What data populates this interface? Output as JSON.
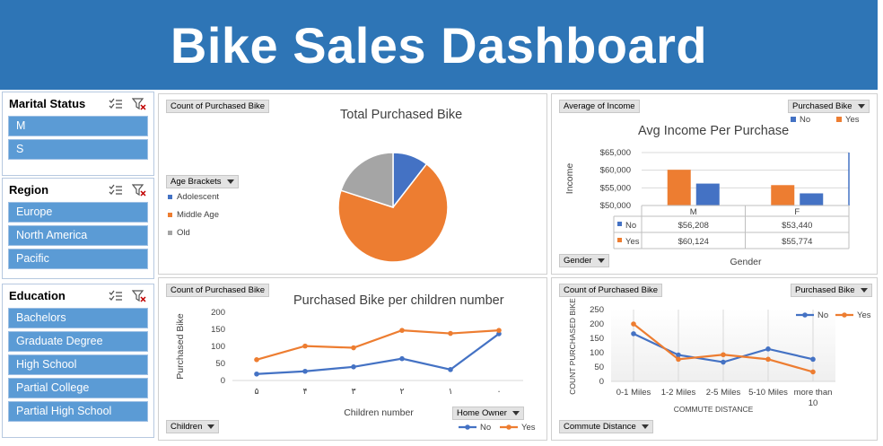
{
  "header": {
    "title": "Bike Sales Dashboard"
  },
  "slicers": {
    "marital": {
      "title": "Marital Status",
      "items": [
        "M",
        "S"
      ]
    },
    "region": {
      "title": "Region",
      "items": [
        "Europe",
        "North America",
        "Pacific"
      ]
    },
    "education": {
      "title": "Education",
      "items": [
        "Bachelors",
        "Graduate Degree",
        "High School",
        "Partial College",
        "Partial High School"
      ]
    }
  },
  "pie_panel": {
    "field_value": "Count of Purchased Bike",
    "legend_field": "Age Brackets",
    "legend_labels": [
      "Adolescent",
      "Middle Age",
      "Old"
    ]
  },
  "income_panel": {
    "field_value": "Average of Income",
    "field_series": "Purchased Bike",
    "field_axis": "Gender",
    "table": {
      "no_label": "No",
      "yes_label": "Yes",
      "no_values": [
        "$56,208",
        "$53,440"
      ],
      "yes_values": [
        "$60,124",
        "$55,774"
      ]
    }
  },
  "children_panel": {
    "field_value": "Count of Purchased Bike",
    "field_axis": "Children",
    "field_series": "Home Owner"
  },
  "commute_panel": {
    "field_value": "Count of Purchased Bike",
    "field_series": "Purchased Bike",
    "field_axis": "Commute Distance"
  },
  "colors": {
    "blue": "#4472c4",
    "orange": "#ed7d31",
    "gray": "#a5a5a5",
    "slicer": "#5b9bd5",
    "header": "#2e75b6"
  },
  "chart_data": [
    {
      "type": "pie",
      "title": "Total Purchased Bike",
      "categories": [
        "Adolescent",
        "Middle Age",
        "Old"
      ],
      "values": [
        10.5,
        69.5,
        20
      ],
      "colors": [
        "#4472c4",
        "#ed7d31",
        "#a5a5a5"
      ]
    },
    {
      "type": "bar",
      "title": "Avg Income Per Purchase",
      "categories": [
        "M",
        "F"
      ],
      "xlabel": "Gender",
      "ylabel": "Income",
      "ylim": [
        50000,
        65000
      ],
      "yticks": [
        "$65,000",
        "$60,000",
        "$55,000",
        "$50,000"
      ],
      "series": [
        {
          "name": "No",
          "values": [
            56208,
            53440
          ],
          "color": "#4472c4"
        },
        {
          "name": "Yes",
          "values": [
            60124,
            55774
          ],
          "color": "#ed7d31"
        }
      ],
      "legend": "top-right"
    },
    {
      "type": "line",
      "title": "Purchased Bike per children number",
      "categories": [
        "۵",
        "۴",
        "۳",
        "۲",
        "۱",
        "۰"
      ],
      "xlabel": "Children number",
      "ylabel": "Purchased Bike",
      "ylim": [
        0,
        200
      ],
      "yticks": [
        "200",
        "150",
        "100",
        "50",
        "0"
      ],
      "series": [
        {
          "name": "No",
          "values": [
            19,
            27,
            40,
            64,
            32,
            137
          ],
          "color": "#4472c4"
        },
        {
          "name": "Yes",
          "values": [
            61,
            101,
            96,
            147,
            138,
            147
          ],
          "color": "#ed7d31"
        }
      ],
      "legend": "bottom-right"
    },
    {
      "type": "line",
      "categories": [
        "0-1 Miles",
        "1-2 Miles",
        "2-5 Miles",
        "5-10 Miles",
        "more than 10"
      ],
      "xlabel": "COMMUTE DISTANCE",
      "ylabel": "COUNT PURCHASED BIKE",
      "ylim": [
        0,
        250
      ],
      "yticks": [
        "250",
        "200",
        "150",
        "100",
        "50",
        "0"
      ],
      "series": [
        {
          "name": "No",
          "values": [
            166,
            92,
            67,
            113,
            77
          ],
          "color": "#4472c4"
        },
        {
          "name": "Yes",
          "values": [
            200,
            77,
            93,
            77,
            33
          ],
          "color": "#ed7d31"
        }
      ],
      "legend": "top-right"
    }
  ]
}
